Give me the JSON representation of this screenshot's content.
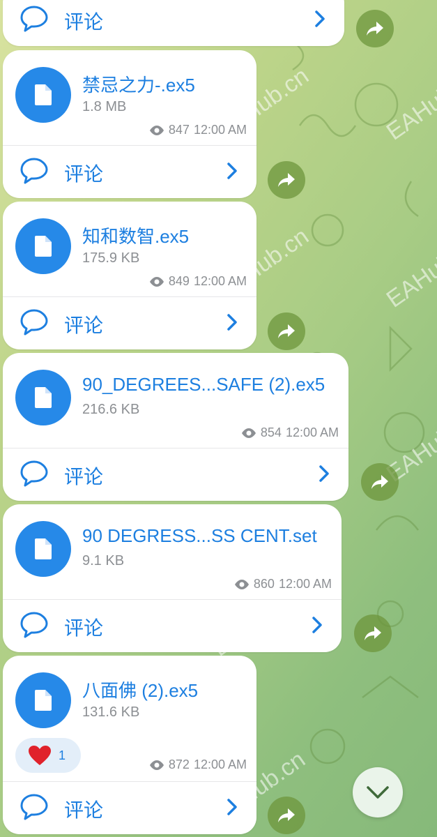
{
  "comment_label": "评论",
  "top_partial": {
    "comment_label": "评论"
  },
  "messages": [
    {
      "file_name": "禁忌之力-.ex5",
      "size": "1.8 MB",
      "views": "847",
      "time": "12:00 AM"
    },
    {
      "file_name": "知和数智.ex5",
      "size": "175.9 KB",
      "views": "849",
      "time": "12:00 AM"
    },
    {
      "file_name": "90_DEGREES...SAFE (2).ex5",
      "size": "216.6 KB",
      "views": "854",
      "time": "12:00 AM"
    },
    {
      "file_name": "90 DEGRESS...SS CENT.set",
      "size": "9.1 KB",
      "views": "860",
      "time": "12:00 AM"
    },
    {
      "file_name": "八面佛 (2).ex5",
      "size": "131.6 KB",
      "views": "872",
      "time": "12:00 AM",
      "reaction": {
        "emoji": "heart",
        "count": "1"
      }
    }
  ],
  "watermark": "EAHub.cn",
  "icons": {
    "file": "file-icon",
    "comment": "comment-bubble-icon",
    "chevron": "chevron-right-icon",
    "share": "share-arrow-icon",
    "eye": "eye-icon",
    "scroll": "chevron-down-icon",
    "heart": "heart-icon"
  },
  "colors": {
    "accent": "#1d7fe0",
    "file_icon_bg": "#2689e8",
    "share_bg": "#7a9a3e",
    "reaction_bg": "#e3eef9",
    "heart": "#e0222b"
  }
}
